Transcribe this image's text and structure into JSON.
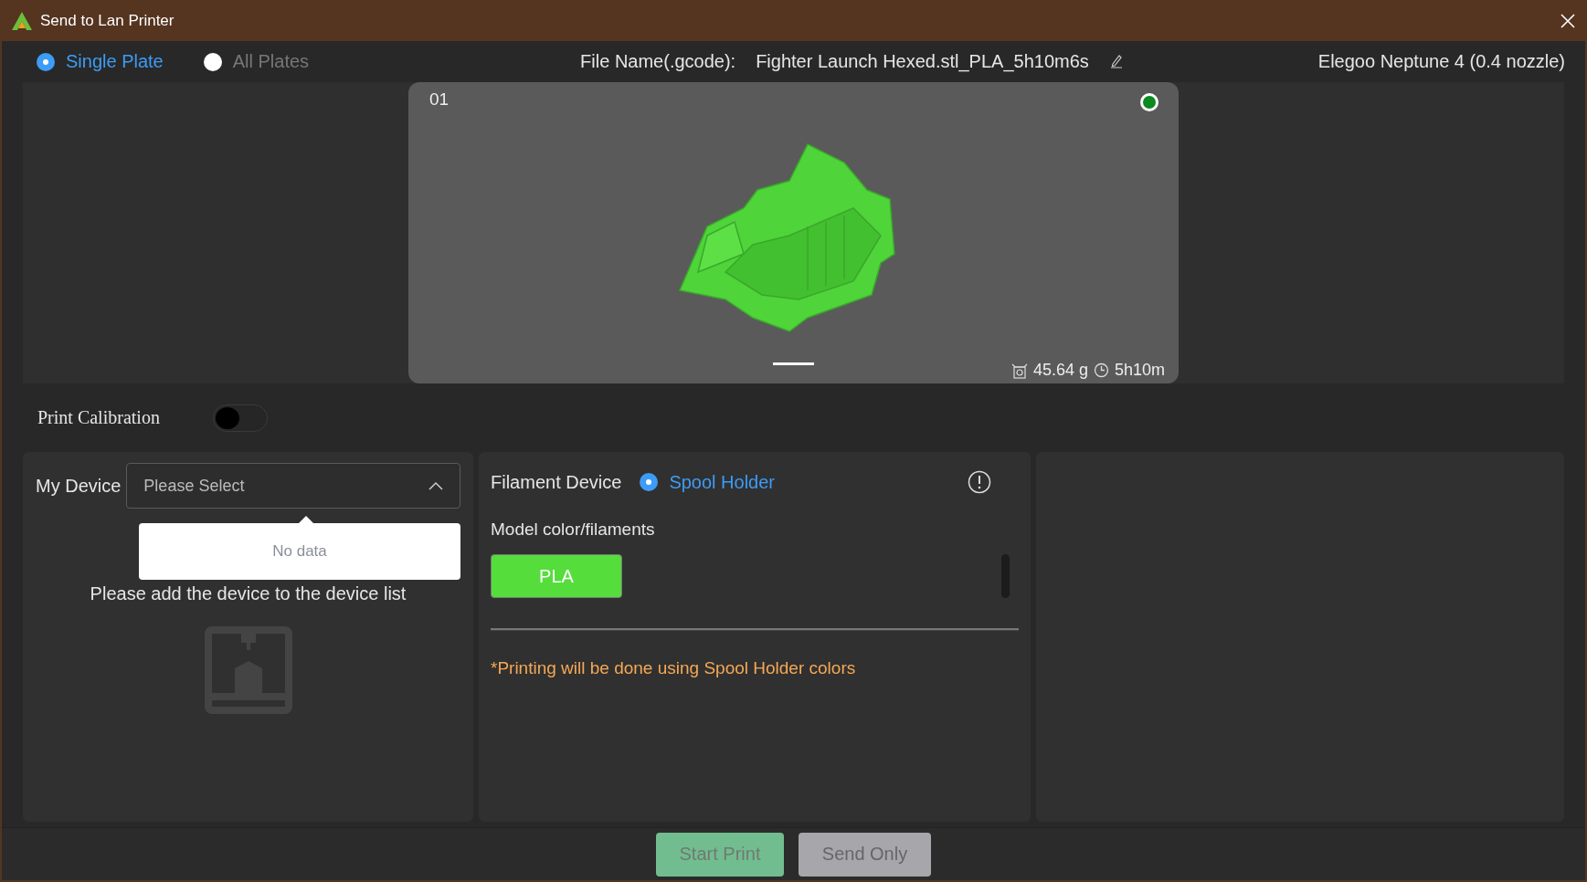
{
  "window": {
    "title": "Send to Lan Printer"
  },
  "plate_mode": [
    {
      "label": "Single Plate",
      "selected": true
    },
    {
      "label": "All Plates",
      "selected": false
    }
  ],
  "file_name": {
    "label": "File Name(.gcode):",
    "value": "Fighter Launch Hexed.stl_PLA_5h10m6s"
  },
  "printer": "Elegoo Neptune 4 (0.4 nozzle)",
  "preview": {
    "plate_number": "01",
    "selected": true,
    "weight": "45.64 g",
    "time": "5h10m"
  },
  "print_calibration": {
    "label": "Print Calibration",
    "on": false
  },
  "my_device": {
    "label": "My Device",
    "placeholder": "Please Select",
    "expanded": true,
    "dropdown_empty": "No data",
    "message": "Please add the device to the device list"
  },
  "filament": {
    "label": "Filament Device",
    "source": {
      "label": "Spool Holder",
      "selected": true
    },
    "subtitle": "Model color/filaments",
    "filaments": [
      {
        "label": "PLA",
        "color": "#55dd3c"
      }
    ],
    "note": "*Printing will be done using Spool Holder colors"
  },
  "buttons": [
    {
      "label": "Start Print",
      "kind": "primary",
      "disabled": true
    },
    {
      "label": "Send Only",
      "kind": "secondary",
      "disabled": true
    }
  ]
}
